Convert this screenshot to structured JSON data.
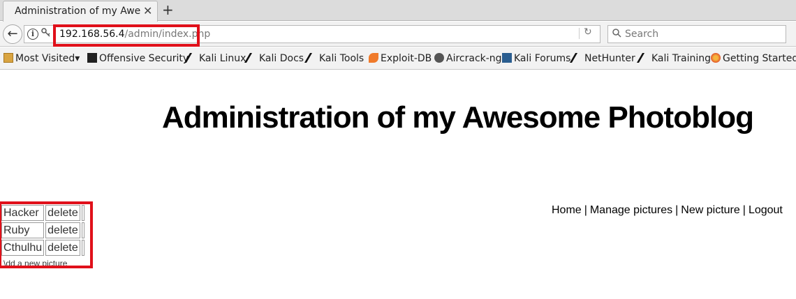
{
  "browser": {
    "tab_title": "Administration of my Awe...",
    "tab_close": "✕",
    "new_tab": "+",
    "url_host": "192.168.56.4",
    "url_path": "/admin/index.php",
    "search_placeholder": "Search",
    "back_glyph": "←",
    "reload_glyph": "↻"
  },
  "bookmarks": [
    {
      "label": "Most Visited",
      "icon": "folder-icon",
      "suffix": "▾"
    },
    {
      "label": "Offensive Security",
      "icon": "offsec-icon"
    },
    {
      "label": "Kali Linux",
      "icon": "kali-dragon-icon"
    },
    {
      "label": "Kali Docs",
      "icon": "kali-dragon-icon"
    },
    {
      "label": "Kali Tools",
      "icon": "kali-dragon-icon"
    },
    {
      "label": "Exploit-DB",
      "icon": "exploitdb-icon"
    },
    {
      "label": "Aircrack-ng",
      "icon": "aircrack-icon"
    },
    {
      "label": "Kali Forums",
      "icon": "kali-forums-icon"
    },
    {
      "label": "NetHunter",
      "icon": "kali-dragon-icon"
    },
    {
      "label": "Kali Training",
      "icon": "kali-dragon-icon"
    },
    {
      "label": "Getting Started",
      "icon": "firefox-icon"
    }
  ],
  "page": {
    "title": "Administration of my Awesome Photoblog",
    "menu": [
      "Home",
      "Manage pictures",
      "New picture",
      "Logout"
    ],
    "menu_sep": "|",
    "pictures": [
      {
        "name": "Hacker",
        "action": "delete"
      },
      {
        "name": "Ruby",
        "action": "delete"
      },
      {
        "name": "Cthulhu",
        "action": "delete"
      }
    ],
    "add_link": "\\dd a new picture"
  },
  "colors": {
    "highlight": "#e0101a",
    "chrome": "#f2f2f2"
  }
}
